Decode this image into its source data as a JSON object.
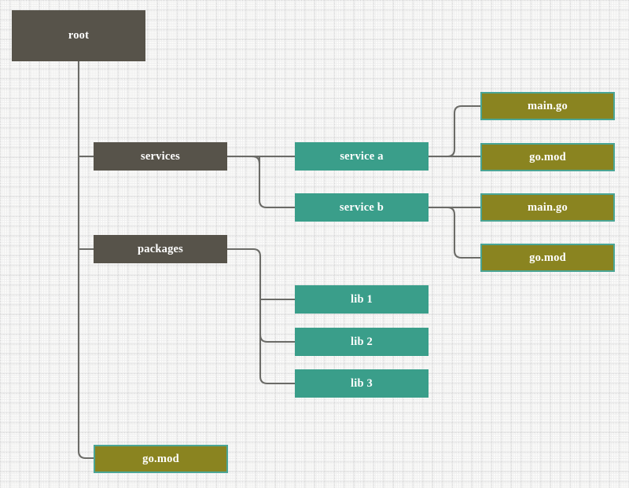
{
  "diagram": {
    "title": "root",
    "type": "tree",
    "background_color": "#fbfbfa",
    "grid": "on",
    "palette": {
      "directory": "#57534a",
      "module": "#3a9e8a",
      "file": "#8a8420",
      "file_border": "#4aa595",
      "edge": "#6b6b67",
      "label": "#ffffff"
    },
    "nodes": {
      "root": "root",
      "services": "services",
      "packages": "packages",
      "service_a": "service a",
      "service_b": "service b",
      "lib1": "lib 1",
      "lib2": "lib 2",
      "lib3": "lib 3",
      "service_a_main": "main.go",
      "service_a_gomod": "go.mod",
      "service_b_main": "main.go",
      "service_b_gomod": "go.mod",
      "root_gomod": "go.mod"
    },
    "tree": [
      {
        "label": "root",
        "kind": "directory",
        "children": [
          {
            "label": "services",
            "kind": "directory",
            "children": [
              {
                "label": "service a",
                "kind": "module",
                "children": [
                  {
                    "label": "main.go",
                    "kind": "file"
                  },
                  {
                    "label": "go.mod",
                    "kind": "file"
                  }
                ]
              },
              {
                "label": "service b",
                "kind": "module",
                "children": [
                  {
                    "label": "main.go",
                    "kind": "file"
                  },
                  {
                    "label": "go.mod",
                    "kind": "file"
                  }
                ]
              }
            ]
          },
          {
            "label": "packages",
            "kind": "directory",
            "children": [
              {
                "label": "lib 1",
                "kind": "module"
              },
              {
                "label": "lib 2",
                "kind": "module"
              },
              {
                "label": "lib 3",
                "kind": "module"
              }
            ]
          },
          {
            "label": "go.mod",
            "kind": "file"
          }
        ]
      }
    ]
  }
}
